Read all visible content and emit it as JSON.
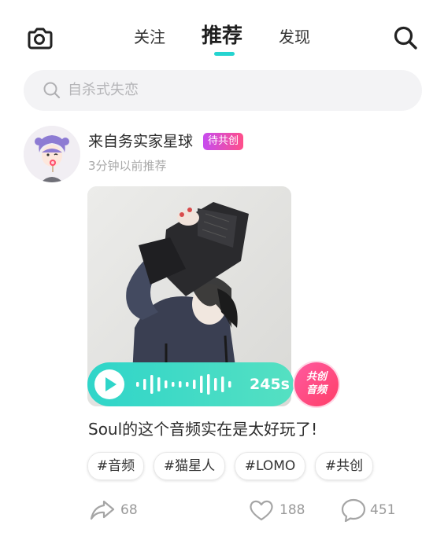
{
  "header": {
    "tabs": [
      {
        "label": "关注"
      },
      {
        "label": "推荐",
        "active": true
      },
      {
        "label": "发现"
      }
    ],
    "left_icon": "camera-icon",
    "right_icon": "search-icon",
    "accent_color": "#25d4d0"
  },
  "search": {
    "placeholder": "自杀式失恋"
  },
  "post": {
    "author": "来自务实家星球",
    "badge": "待共创",
    "time": "3分钟以前推荐",
    "audio": {
      "duration": "245s"
    },
    "cocreate_badge": [
      "共创",
      "音频"
    ],
    "caption": "Soul的这个音频实在是太好玩了!",
    "tags": [
      "#音频",
      "#猫星人",
      "#LOMO",
      "#共创"
    ],
    "actions": {
      "share_count": "68",
      "like_count": "188",
      "comment_count": "451"
    }
  }
}
